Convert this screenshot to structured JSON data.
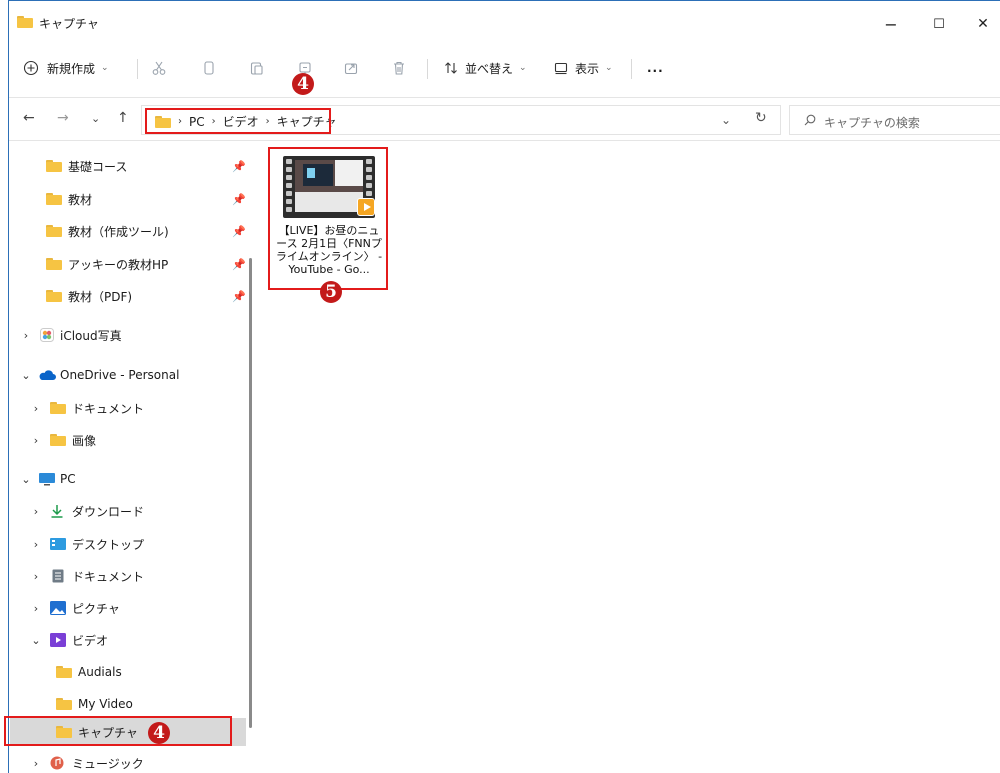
{
  "window": {
    "title": "キャプチャ",
    "minimize": "−",
    "maximize": "☐",
    "close": "✕"
  },
  "toolbar": {
    "new_label": "新規作成",
    "sort_label": "並べ替え",
    "view_label": "表示",
    "more_label": "..."
  },
  "nav": {
    "back": "←",
    "forward": "→",
    "recent": "⌄",
    "up": "↑",
    "breadcrumbs": [
      "PC",
      "ビデオ",
      "キャプチャ"
    ],
    "crumb_sep": "›",
    "dropdown": "⌄",
    "refresh": "↻",
    "search_placeholder": "キャプチャの検索"
  },
  "sidebar": {
    "pinned": [
      {
        "label": "基礎コース"
      },
      {
        "label": "教材"
      },
      {
        "label": "教材（作成ツール)"
      },
      {
        "label": "アッキーの教材HP"
      },
      {
        "label": "教材（PDF)"
      }
    ],
    "icloud": "iCloud写真",
    "onedrive": "OneDrive - Personal",
    "onedrive_children": [
      "ドキュメント",
      "画像"
    ],
    "pc": "PC",
    "pc_children": [
      "ダウンロード",
      "デスクトップ",
      "ドキュメント",
      "ピクチャ",
      "ビデオ"
    ],
    "video_children": [
      "Audials",
      "My Video",
      "キャプチャ"
    ],
    "music": "ミュージック"
  },
  "file": {
    "name": "【LIVE】お昼のニュース 2月1日〈FNNプライムオンライン〉 - YouTube - Go..."
  },
  "badges": {
    "address": "4",
    "sidebar": "4",
    "file": "5"
  },
  "colors": {
    "highlight": "#e31b1b",
    "badge": "#c31a1a",
    "folder": "#f6c443",
    "selected": "#d9d9d9"
  }
}
